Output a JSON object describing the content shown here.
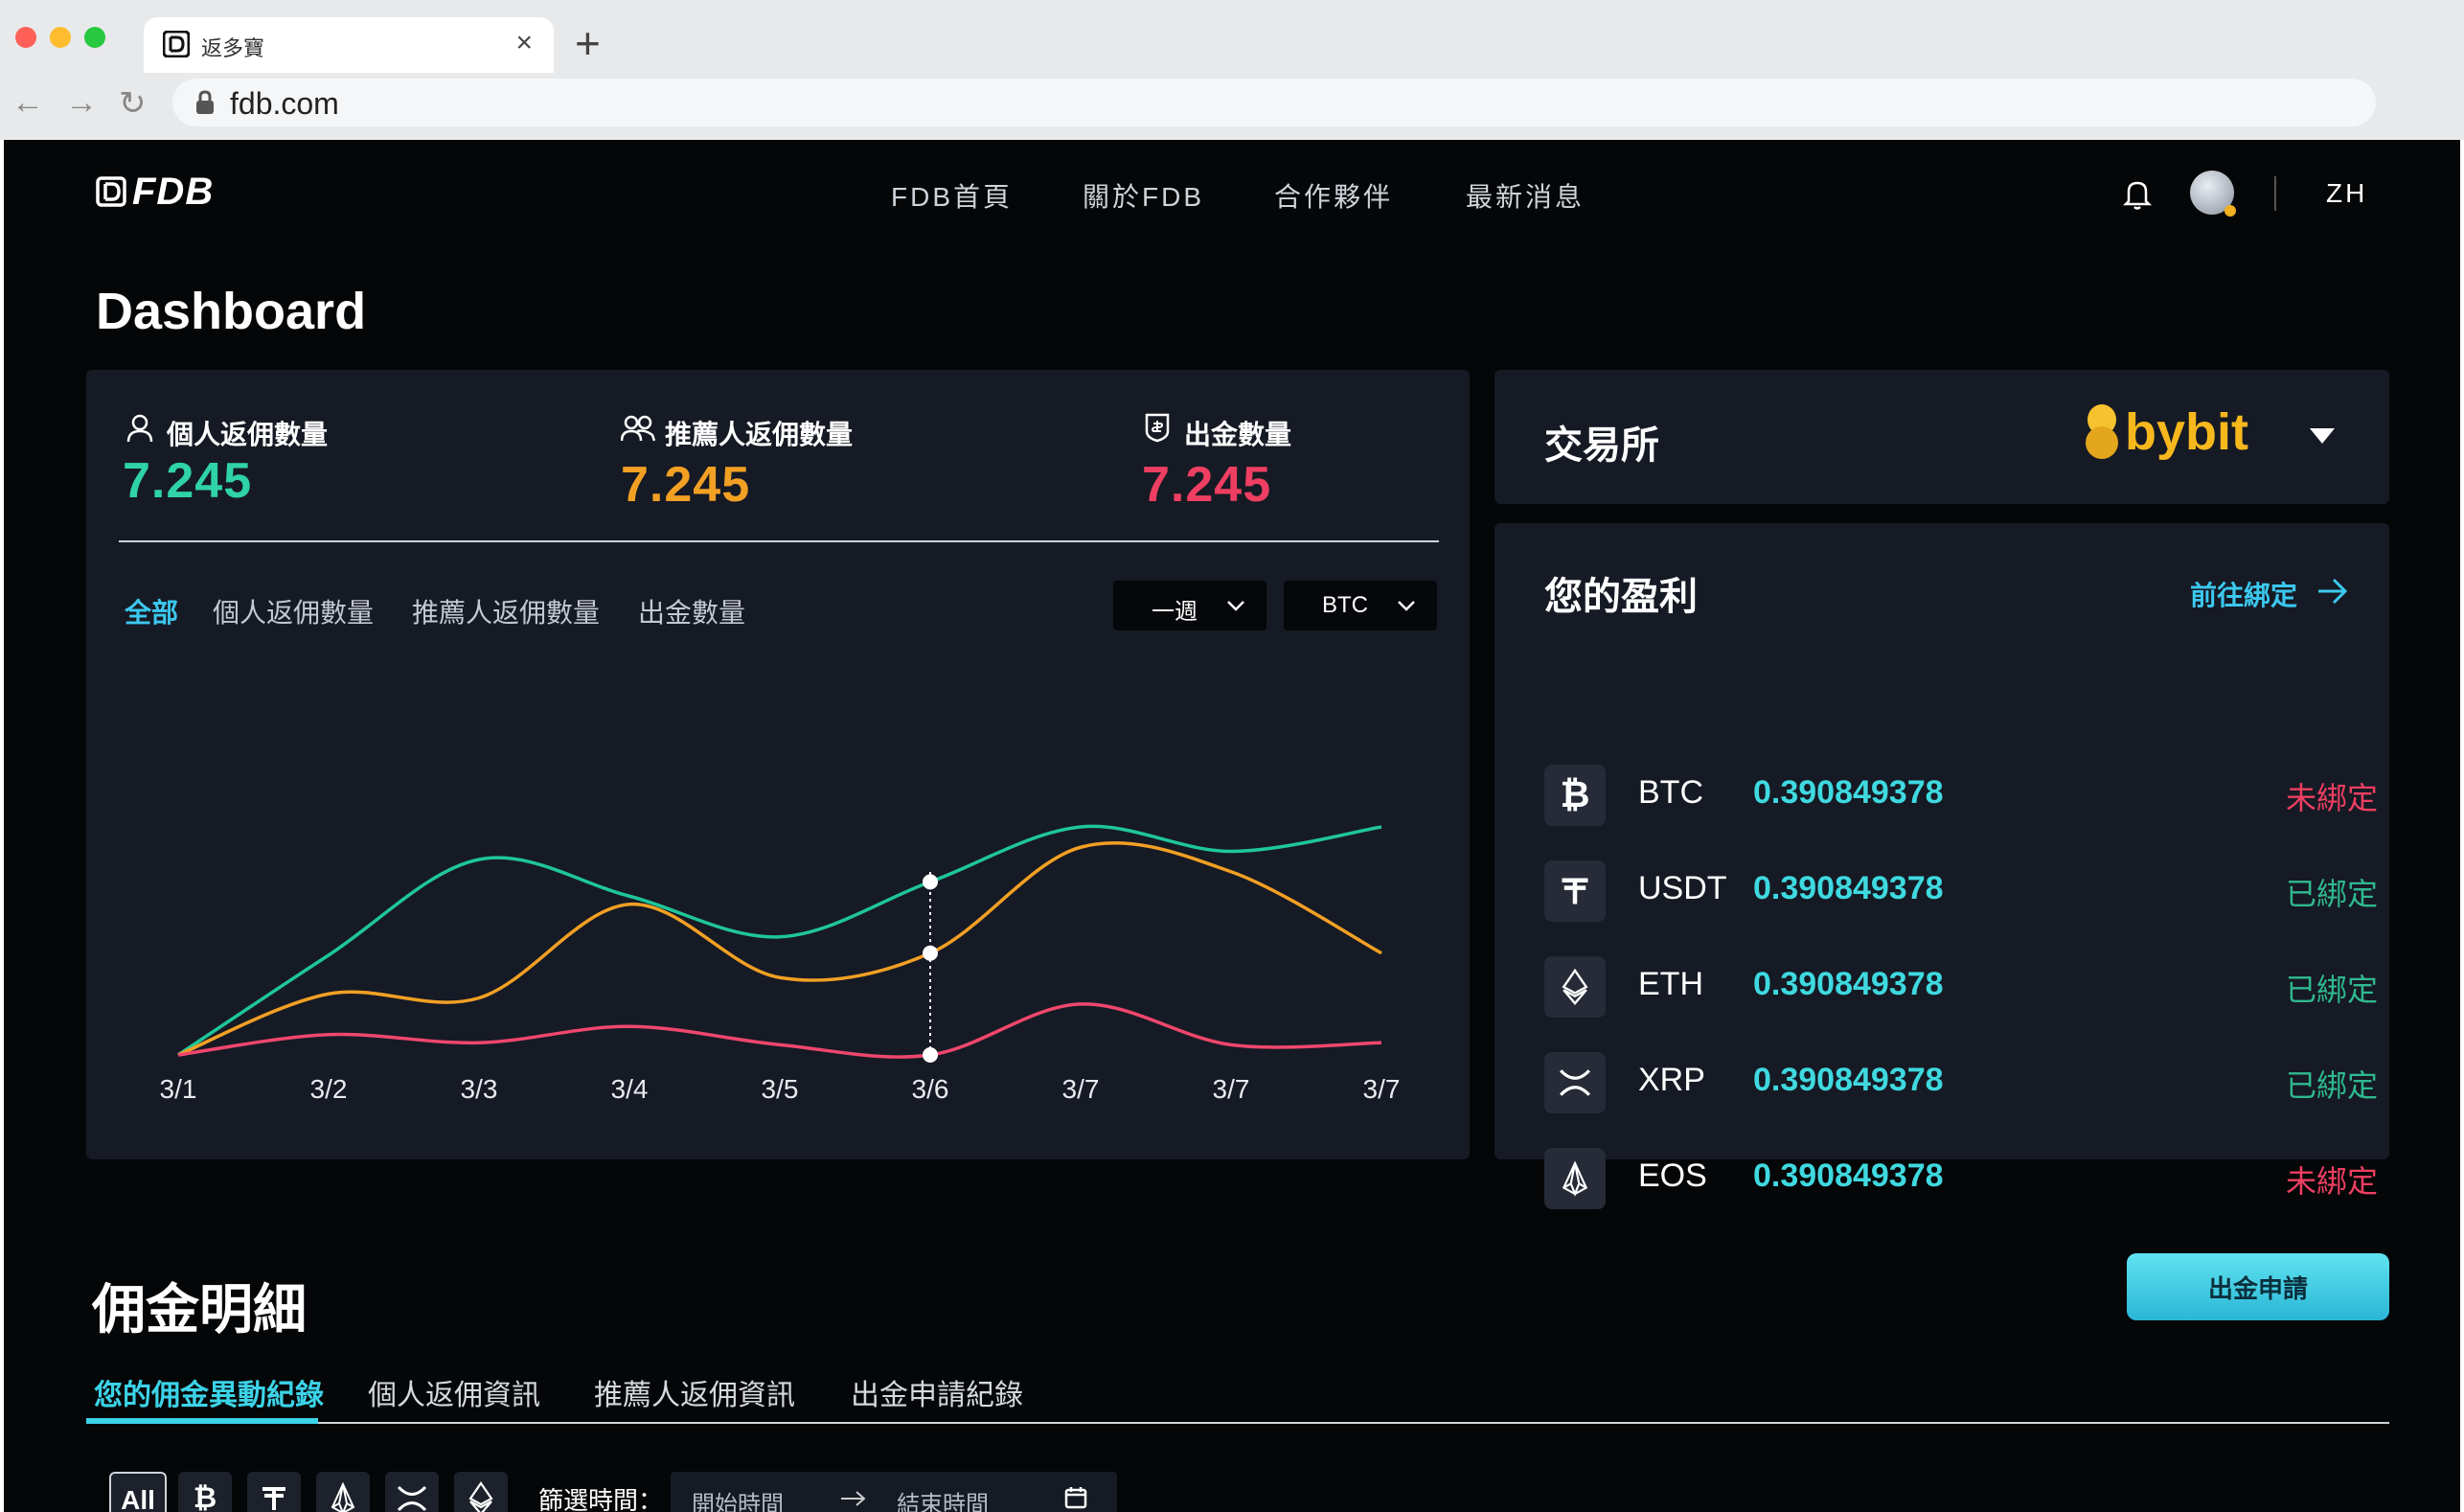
{
  "browser": {
    "tab_title": "返多寶",
    "url": "fdb.com"
  },
  "nav": {
    "logo": "FDB",
    "links": [
      "FDB首頁",
      "關於FDB",
      "合作夥伴",
      "最新消息"
    ],
    "language": "ZH"
  },
  "page_title": "Dashboard",
  "metrics": [
    {
      "label": "個人返佣數量",
      "value": "7.245",
      "color": "#2fd3a5"
    },
    {
      "label": "推薦人返佣數量",
      "value": "7.245",
      "color": "#f2a024"
    },
    {
      "label": "出金數量",
      "value": "7.245",
      "color": "#ee3f62"
    }
  ],
  "chart_filters": {
    "tabs": [
      "全部",
      "個人返佣數量",
      "推薦人返佣數量",
      "出金數量"
    ],
    "active_tab": "全部",
    "period": "一週",
    "currency": "BTC"
  },
  "chart_data": {
    "type": "line",
    "x": [
      "3/1",
      "3/2",
      "3/3",
      "3/4",
      "3/5",
      "3/6",
      "3/7",
      "3/7",
      "3/7"
    ],
    "series": [
      {
        "color": "#1fc69a",
        "values": [
          0.0,
          4.9,
          9.6,
          7.8,
          5.8,
          8.5,
          11.2,
          10.0,
          11.2
        ]
      },
      {
        "color": "#f2a024",
        "values": [
          0.0,
          3.0,
          2.8,
          7.4,
          3.8,
          5.0,
          10.2,
          9.0,
          5.0
        ]
      },
      {
        "color": "#f0476d",
        "values": [
          0.0,
          1.0,
          0.6,
          1.4,
          0.5,
          0.0,
          2.5,
          0.5,
          0.6
        ]
      }
    ],
    "ylim": [
      0,
      12
    ],
    "highlight_index": 5,
    "grid": false
  },
  "exchange": {
    "label": "交易所",
    "brand": "bybit"
  },
  "profit": {
    "title": "您的盈利",
    "link_label": "前往綁定",
    "coins": [
      {
        "symbol": "BTC",
        "icon": "bitcoin-icon",
        "value": "0.390849378",
        "status": "未綁定",
        "status_color": "#ee3f62"
      },
      {
        "symbol": "USDT",
        "icon": "tether-icon",
        "value": "0.390849378",
        "status": "已綁定",
        "status_color": "#2fb98f"
      },
      {
        "symbol": "ETH",
        "icon": "ethereum-icon",
        "value": "0.390849378",
        "status": "已綁定",
        "status_color": "#2fb98f"
      },
      {
        "symbol": "XRP",
        "icon": "xrp-icon",
        "value": "0.390849378",
        "status": "已綁定",
        "status_color": "#2fb98f"
      },
      {
        "symbol": "EOS",
        "icon": "eos-icon",
        "value": "0.390849378",
        "status": "未綁定",
        "status_color": "#ee3f62"
      }
    ]
  },
  "commission": {
    "title": "佣金明細",
    "withdraw_button": "出金申請",
    "tabs": [
      "您的佣金異動紀錄",
      "個人返佣資訊",
      "推薦人返佣資訊",
      "出金申請紀錄"
    ],
    "active_tab": "您的佣金異動紀錄",
    "filter_all": "All",
    "filter_time_label": "篩選時間：",
    "start_placeholder": "開始時間",
    "end_placeholder": "結束時間"
  }
}
